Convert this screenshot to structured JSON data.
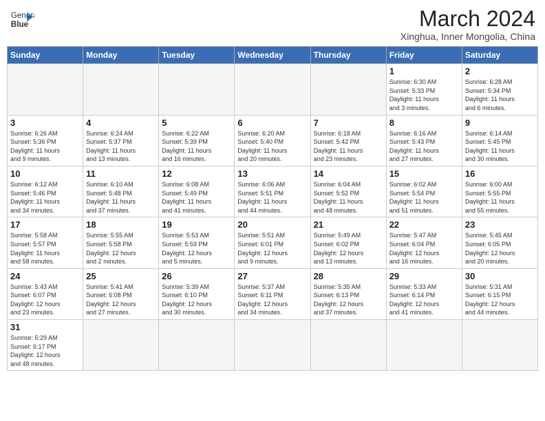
{
  "header": {
    "logo_text_normal": "General",
    "logo_text_bold": "Blue",
    "month_title": "March 2024",
    "location": "Xinghua, Inner Mongolia, China"
  },
  "weekdays": [
    "Sunday",
    "Monday",
    "Tuesday",
    "Wednesday",
    "Thursday",
    "Friday",
    "Saturday"
  ],
  "weeks": [
    [
      {
        "day": "",
        "info": ""
      },
      {
        "day": "",
        "info": ""
      },
      {
        "day": "",
        "info": ""
      },
      {
        "day": "",
        "info": ""
      },
      {
        "day": "",
        "info": ""
      },
      {
        "day": "1",
        "info": "Sunrise: 6:30 AM\nSunset: 5:33 PM\nDaylight: 11 hours\nand 3 minutes."
      },
      {
        "day": "2",
        "info": "Sunrise: 6:28 AM\nSunset: 5:34 PM\nDaylight: 11 hours\nand 6 minutes."
      }
    ],
    [
      {
        "day": "3",
        "info": "Sunrise: 6:26 AM\nSunset: 5:36 PM\nDaylight: 11 hours\nand 9 minutes."
      },
      {
        "day": "4",
        "info": "Sunrise: 6:24 AM\nSunset: 5:37 PM\nDaylight: 11 hours\nand 13 minutes."
      },
      {
        "day": "5",
        "info": "Sunrise: 6:22 AM\nSunset: 5:39 PM\nDaylight: 11 hours\nand 16 minutes."
      },
      {
        "day": "6",
        "info": "Sunrise: 6:20 AM\nSunset: 5:40 PM\nDaylight: 11 hours\nand 20 minutes."
      },
      {
        "day": "7",
        "info": "Sunrise: 6:18 AM\nSunset: 5:42 PM\nDaylight: 11 hours\nand 23 minutes."
      },
      {
        "day": "8",
        "info": "Sunrise: 6:16 AM\nSunset: 5:43 PM\nDaylight: 11 hours\nand 27 minutes."
      },
      {
        "day": "9",
        "info": "Sunrise: 6:14 AM\nSunset: 5:45 PM\nDaylight: 11 hours\nand 30 minutes."
      }
    ],
    [
      {
        "day": "10",
        "info": "Sunrise: 6:12 AM\nSunset: 5:46 PM\nDaylight: 11 hours\nand 34 minutes."
      },
      {
        "day": "11",
        "info": "Sunrise: 6:10 AM\nSunset: 5:48 PM\nDaylight: 11 hours\nand 37 minutes."
      },
      {
        "day": "12",
        "info": "Sunrise: 6:08 AM\nSunset: 5:49 PM\nDaylight: 11 hours\nand 41 minutes."
      },
      {
        "day": "13",
        "info": "Sunrise: 6:06 AM\nSunset: 5:51 PM\nDaylight: 11 hours\nand 44 minutes."
      },
      {
        "day": "14",
        "info": "Sunrise: 6:04 AM\nSunset: 5:52 PM\nDaylight: 11 hours\nand 48 minutes."
      },
      {
        "day": "15",
        "info": "Sunrise: 6:02 AM\nSunset: 5:54 PM\nDaylight: 11 hours\nand 51 minutes."
      },
      {
        "day": "16",
        "info": "Sunrise: 6:00 AM\nSunset: 5:55 PM\nDaylight: 11 hours\nand 55 minutes."
      }
    ],
    [
      {
        "day": "17",
        "info": "Sunrise: 5:58 AM\nSunset: 5:57 PM\nDaylight: 11 hours\nand 58 minutes."
      },
      {
        "day": "18",
        "info": "Sunrise: 5:55 AM\nSunset: 5:58 PM\nDaylight: 12 hours\nand 2 minutes."
      },
      {
        "day": "19",
        "info": "Sunrise: 5:53 AM\nSunset: 5:59 PM\nDaylight: 12 hours\nand 5 minutes."
      },
      {
        "day": "20",
        "info": "Sunrise: 5:51 AM\nSunset: 6:01 PM\nDaylight: 12 hours\nand 9 minutes."
      },
      {
        "day": "21",
        "info": "Sunrise: 5:49 AM\nSunset: 6:02 PM\nDaylight: 12 hours\nand 13 minutes."
      },
      {
        "day": "22",
        "info": "Sunrise: 5:47 AM\nSunset: 6:04 PM\nDaylight: 12 hours\nand 16 minutes."
      },
      {
        "day": "23",
        "info": "Sunrise: 5:45 AM\nSunset: 6:05 PM\nDaylight: 12 hours\nand 20 minutes."
      }
    ],
    [
      {
        "day": "24",
        "info": "Sunrise: 5:43 AM\nSunset: 6:07 PM\nDaylight: 12 hours\nand 23 minutes."
      },
      {
        "day": "25",
        "info": "Sunrise: 5:41 AM\nSunset: 6:08 PM\nDaylight: 12 hours\nand 27 minutes."
      },
      {
        "day": "26",
        "info": "Sunrise: 5:39 AM\nSunset: 6:10 PM\nDaylight: 12 hours\nand 30 minutes."
      },
      {
        "day": "27",
        "info": "Sunrise: 5:37 AM\nSunset: 6:11 PM\nDaylight: 12 hours\nand 34 minutes."
      },
      {
        "day": "28",
        "info": "Sunrise: 5:35 AM\nSunset: 6:13 PM\nDaylight: 12 hours\nand 37 minutes."
      },
      {
        "day": "29",
        "info": "Sunrise: 5:33 AM\nSunset: 6:14 PM\nDaylight: 12 hours\nand 41 minutes."
      },
      {
        "day": "30",
        "info": "Sunrise: 5:31 AM\nSunset: 6:15 PM\nDaylight: 12 hours\nand 44 minutes."
      }
    ],
    [
      {
        "day": "31",
        "info": "Sunrise: 5:29 AM\nSunset: 6:17 PM\nDaylight: 12 hours\nand 48 minutes."
      },
      {
        "day": "",
        "info": ""
      },
      {
        "day": "",
        "info": ""
      },
      {
        "day": "",
        "info": ""
      },
      {
        "day": "",
        "info": ""
      },
      {
        "day": "",
        "info": ""
      },
      {
        "day": "",
        "info": ""
      }
    ]
  ]
}
